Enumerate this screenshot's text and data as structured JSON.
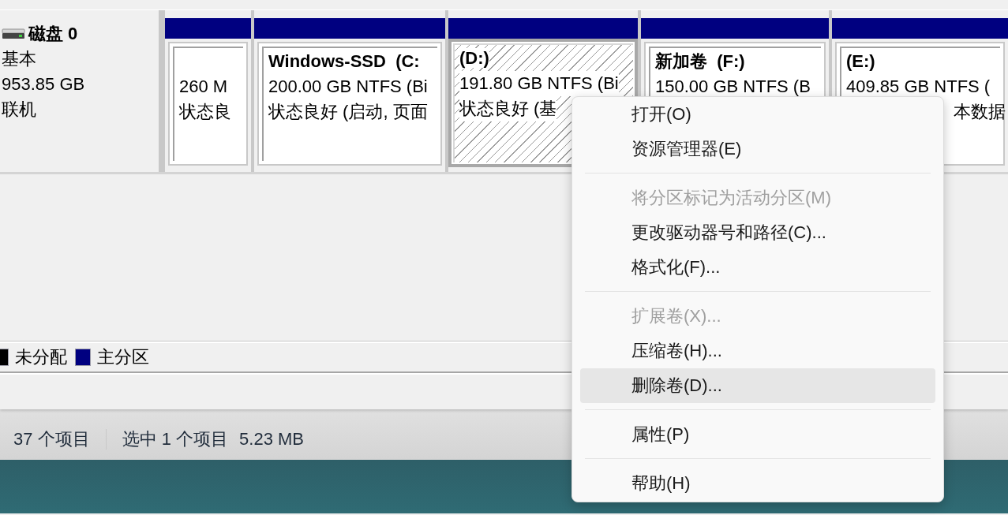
{
  "disk": {
    "title": "磁盘 0",
    "type": "基本",
    "size": "953.85 GB",
    "status": "联机"
  },
  "partitions": [
    {
      "line_1": "260 M",
      "line_2": "状态良",
      "selected": false
    },
    {
      "label": "Windows-SSD  (C:",
      "line_1": "200.00 GB NTFS (Bi",
      "line_2": "状态良好 (启动, 页面",
      "selected": false
    },
    {
      "label": "(D:)",
      "line_1": "191.80 GB NTFS (Bi",
      "line_2": "状态良好 (基",
      "selected": true
    },
    {
      "label": "新加卷  (F:)",
      "line_1": "150.00 GB NTFS (B",
      "selected": false
    },
    {
      "label": "(E:)",
      "line_1": "409.85 GB NTFS (",
      "line_2_tail": "本数据",
      "selected": false
    }
  ],
  "legend": [
    {
      "label": "未分配",
      "color": "#000000"
    },
    {
      "label": "主分区",
      "color": "#000080"
    }
  ],
  "status_bar": {
    "item_count": "37 个项目",
    "selection": "选中 1 个项目",
    "size": "5.23 MB"
  },
  "context_menu": [
    {
      "kind": "item",
      "label": "打开(O)",
      "disabled": false,
      "selected": false
    },
    {
      "kind": "item",
      "label": "资源管理器(E)",
      "disabled": false,
      "selected": false
    },
    {
      "kind": "separator"
    },
    {
      "kind": "item",
      "label": "将分区标记为活动分区(M)",
      "disabled": true,
      "selected": false
    },
    {
      "kind": "item",
      "label": "更改驱动器号和路径(C)...",
      "disabled": false,
      "selected": false
    },
    {
      "kind": "item",
      "label": "格式化(F)...",
      "disabled": false,
      "selected": false
    },
    {
      "kind": "separator"
    },
    {
      "kind": "item",
      "label": "扩展卷(X)...",
      "disabled": true,
      "selected": false
    },
    {
      "kind": "item",
      "label": "压缩卷(H)...",
      "disabled": false,
      "selected": false
    },
    {
      "kind": "item",
      "label": "删除卷(D)...",
      "disabled": false,
      "selected": true
    },
    {
      "kind": "separator"
    },
    {
      "kind": "item",
      "label": "属性(P)",
      "disabled": false,
      "selected": false
    },
    {
      "kind": "separator"
    },
    {
      "kind": "item",
      "label": "帮助(H)",
      "disabled": false,
      "selected": false
    }
  ]
}
